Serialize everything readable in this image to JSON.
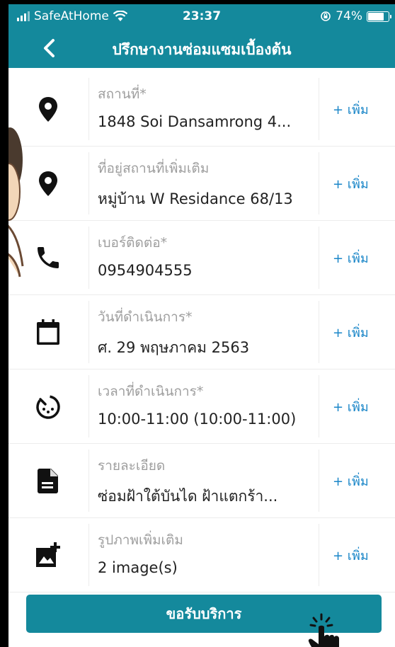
{
  "status_bar": {
    "carrier": "SafeAtHome",
    "time": "23:37",
    "battery": "74%"
  },
  "header": {
    "title": "ปรึกษางานซ่อมแซมเบื้องต้น"
  },
  "rows": [
    {
      "label": "สถานที่*",
      "value": "1848 Soi Dansamrong 4...",
      "action": "+ เพิ่ม",
      "icon": "location-pin-icon"
    },
    {
      "label": "ที่อยู่สถานที่เพิ่มเติม",
      "value": "หมู่บ้าน W Residance 68/13",
      "action": "+ เพิ่ม",
      "icon": "location-pin-icon"
    },
    {
      "label": "เบอร์ติดต่อ*",
      "value": "0954904555",
      "action": "+ เพิ่ม",
      "icon": "phone-icon"
    },
    {
      "label": "วันที่ดำเนินการ*",
      "value": "ศ. 29 พฤษภาคม 2563",
      "action": "+ เพิ่ม",
      "icon": "calendar-icon"
    },
    {
      "label": "เวลาที่ดำเนินการ*",
      "value": "10:00-11:00 (10:00-11:00)",
      "action": "+ เพิ่ม",
      "icon": "timer-icon"
    },
    {
      "label": "รายละเอียด",
      "value": "ซ่อมฝ้าใต้บันได ฝ้าแตกร้า...",
      "action": "+ เพิ่ม",
      "icon": "document-icon"
    },
    {
      "label": "รูปภาพเพิ่มเติม",
      "value": "2 image(s)",
      "action": "+ เพิ่ม",
      "icon": "add-photo-icon"
    }
  ],
  "submit": {
    "label": "ขอรับบริการ"
  },
  "colors": {
    "primary": "#14899c",
    "link": "#1a86c8",
    "label": "#9e9e9e"
  }
}
